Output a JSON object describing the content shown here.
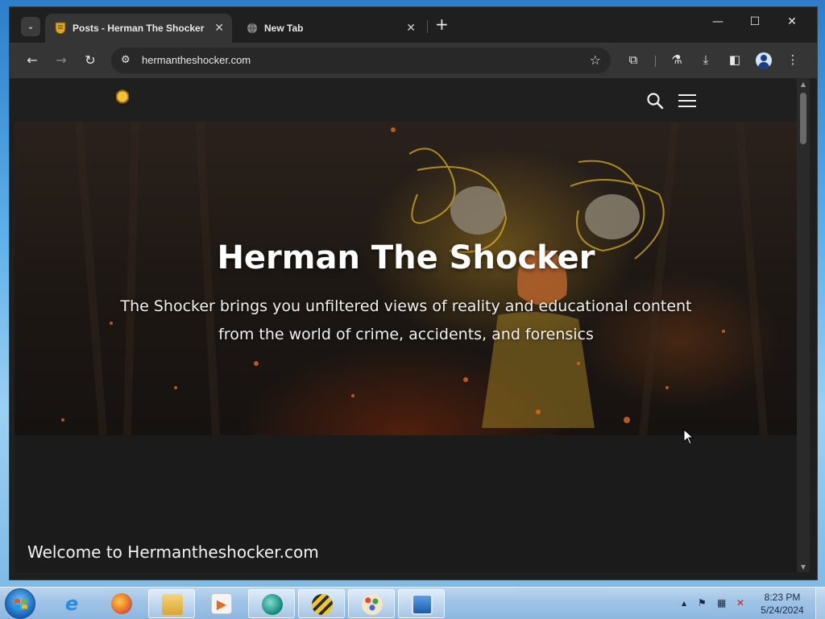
{
  "browser": {
    "tabs": [
      {
        "title": "Posts - Herman The Shocker",
        "active": true
      },
      {
        "title": "New Tab",
        "active": false
      }
    ],
    "close_glyph": "✕",
    "new_tab_glyph": "+",
    "tab_search_glyph": "⌄",
    "window_controls": {
      "minimize": "—",
      "maximize": "☐",
      "close": "✕"
    },
    "nav": {
      "back": "←",
      "forward": "→",
      "reload": "↻"
    },
    "url": "hermantheshocker.com",
    "site_info_glyph": "⚙",
    "bookmark_glyph": "☆",
    "toolbar_icons": {
      "extensions": "⧉",
      "labs": "⚗",
      "downloads": "⤓",
      "side_panel": "◧",
      "menu": "⋮"
    }
  },
  "site": {
    "hero_title": "Herman The Shocker",
    "hero_subtitle": "The Shocker brings you unfiltered views of reality and educational content from the world of crime, accidents, and forensics",
    "welcome_heading": "Welcome to Hermantheshocker.com"
  },
  "scrollbar": {
    "up": "▲",
    "down": "▼"
  },
  "taskbar": {
    "apps": [
      {
        "name": "internet-explorer",
        "glyph": "e",
        "color": "#2a8be0"
      },
      {
        "name": "firefox",
        "glyph": "●",
        "color": "#e8702a"
      },
      {
        "name": "file-explorer",
        "glyph": "▤",
        "color": "#e0b040"
      },
      {
        "name": "media-player",
        "glyph": "▶",
        "color": "#e86a1a"
      },
      {
        "name": "chrome-app",
        "glyph": "◉",
        "color": "#2aa8a0"
      },
      {
        "name": "bee-app",
        "glyph": "✦",
        "color": "#e0c030"
      },
      {
        "name": "paint",
        "glyph": "✎",
        "color": "#7aa0d0"
      },
      {
        "name": "remote-desktop",
        "glyph": "▣",
        "color": "#3a78c8"
      }
    ],
    "tray": {
      "chevron": "▲",
      "flag": "⚑",
      "network": "▦",
      "volume": "✕"
    },
    "time": "8:23 PM",
    "date": "5/24/2024"
  }
}
